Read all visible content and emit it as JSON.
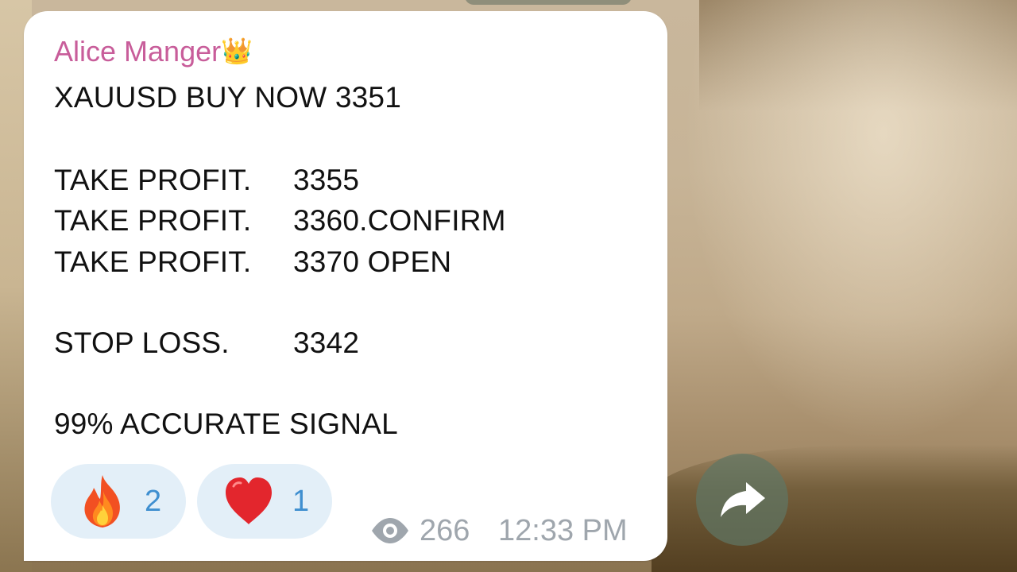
{
  "message": {
    "sender_name": "Alice Manger",
    "sender_badge": "👑",
    "lines": {
      "headline": "XAUUSD BUY NOW 3351",
      "tp1_label": "TAKE PROFIT.",
      "tp1_value": "3355",
      "tp2_label": "TAKE PROFIT.",
      "tp2_value": "3360.CONFIRM",
      "tp3_label": "TAKE PROFIT.",
      "tp3_value": "3370 OPEN",
      "sl_label": "STOP LOSS.",
      "sl_value": "3342",
      "footer": "99% ACCURATE SIGNAL"
    },
    "reactions": [
      {
        "icon": "fire-icon",
        "count": "2"
      },
      {
        "icon": "heart-icon",
        "count": "1"
      }
    ],
    "views": "266",
    "time": "12:33 PM"
  },
  "colors": {
    "sender": "#c85d9a",
    "reaction_bg": "#e3eff8",
    "reaction_count": "#3f8fd0",
    "meta": "#9fa6ad",
    "bubble": "#ffffff"
  }
}
